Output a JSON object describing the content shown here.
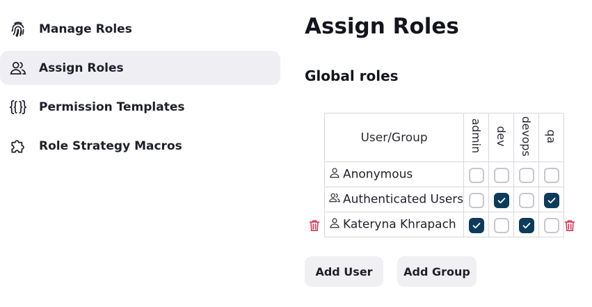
{
  "sidebar": {
    "items": [
      {
        "label": "Manage Roles",
        "icon": "fingerprint-icon"
      },
      {
        "label": "Assign Roles",
        "icon": "users-icon",
        "active": true
      },
      {
        "label": "Permission Templates",
        "icon": "braces-icon"
      },
      {
        "label": "Role Strategy Macros",
        "icon": "puzzle-icon"
      }
    ]
  },
  "page": {
    "title": "Assign Roles",
    "section_title": "Global roles"
  },
  "table": {
    "user_header": "User/Group",
    "roles": [
      "admin",
      "dev",
      "devops",
      "qa"
    ],
    "rows": [
      {
        "name": "Anonymous",
        "type": "user",
        "checks": [
          false,
          false,
          false,
          false
        ]
      },
      {
        "name": "Authenticated Users",
        "type": "group",
        "checks": [
          false,
          true,
          false,
          true
        ]
      },
      {
        "name": "Kateryna Khrapach",
        "type": "user",
        "checks": [
          true,
          false,
          true,
          false
        ]
      }
    ]
  },
  "buttons": {
    "add_user": "Add User",
    "add_group": "Add Group"
  },
  "colors": {
    "checked": "#0c3b5c",
    "delete": "#e0294a",
    "active_bg": "#efeff3"
  }
}
